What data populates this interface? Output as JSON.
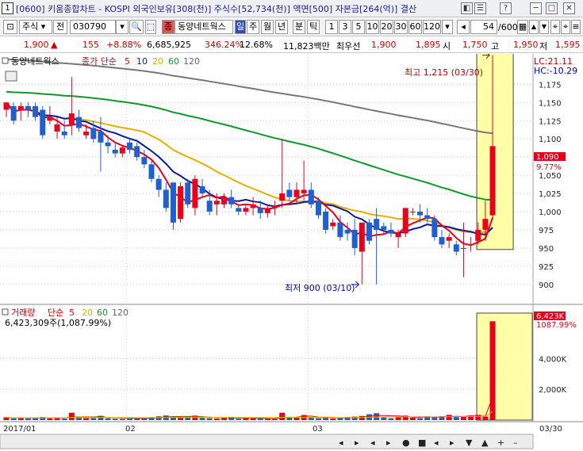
{
  "window": {
    "number": "1",
    "title": "[0600] 키움종합차트 - KOSPI 외국인보유[308(천)] 주식수[52,734(천)] 액면[500] 자본금[264(억)] 결산",
    "buttons": [
      "◧",
      "☰",
      "?",
      "─",
      "□",
      "✕"
    ]
  },
  "toolbar": {
    "asset_type": "주식",
    "jeon_label": "전",
    "code": "030790",
    "search_icon": "search-icon",
    "jong_label": "종",
    "stock_name": "동양네트웍스",
    "periods": [
      "일",
      "주",
      "월",
      "년",
      "분",
      "틱"
    ],
    "selected_period": "일",
    "intervals": [
      "1",
      "3",
      "5",
      "10",
      "20",
      "30",
      "60",
      "120"
    ],
    "count": "54",
    "total": "/600",
    "icons": [
      "left-arrow-icon",
      "grid-icon",
      "up-triangle-icon",
      "down-triangle-icon",
      "pin-icon",
      "pin-icon",
      "menu-icon"
    ]
  },
  "quote": {
    "price": "1,900",
    "arrow": "▲",
    "change": "155",
    "change_pct": "+8.88%",
    "volume": "6,685,925",
    "volume_ratio": "346.24%",
    "turnover": "12.68%",
    "amount": "11,823백만",
    "pref_label": "최우선",
    "ask": "1,900",
    "bid": "1,895",
    "open_label": "시",
    "open": "1,750",
    "high_label": "고",
    "high": "1,950",
    "low_label": "저",
    "low": "1,595"
  },
  "price_panel": {
    "stock_name": "동양네트웍스",
    "ma_title": "종가 단순",
    "ma_periods": [
      "5",
      "10",
      "20",
      "60",
      "120"
    ],
    "lc": "LC:21.11",
    "hc": "HC:-10.29",
    "last_price_label": "1,090",
    "last_pct_label": "9.77%",
    "high_annotation": "최고 1,215 (03/30)",
    "low_annotation": "최저 900 (03/10)"
  },
  "volume_panel": {
    "title": "거래량",
    "ma_title": "단순",
    "ma_periods": [
      "5",
      "20",
      "60",
      "120"
    ],
    "summary": "6,423,309주(1,087.99%)",
    "last_label": "6,423K",
    "last_pct": "1087.99%"
  },
  "chart_data": {
    "type": "candlestick",
    "price_ticks": [
      "1,175",
      "1,150",
      "1,125",
      "1,100",
      "1,075",
      "1,050",
      "1,025",
      "1,000",
      "975",
      "950",
      "925",
      "900"
    ],
    "price_ylim": [
      890,
      1195
    ],
    "volume_ticks": [
      "4,000K",
      "2,000K"
    ],
    "volume_ylim": [
      0,
      6800
    ],
    "x_labels": [
      "2017/01",
      "02",
      "03",
      "03/30"
    ],
    "ma_colors": {
      "5": "#e8001c",
      "10": "#0a1aa0",
      "20": "#e6b000",
      "60": "#0c9a2a",
      "120": "#777777"
    },
    "candles": [
      {
        "o": 1140,
        "h": 1150,
        "l": 1130,
        "c": 1150
      },
      {
        "o": 1145,
        "h": 1150,
        "l": 1120,
        "c": 1125
      },
      {
        "o": 1140,
        "h": 1150,
        "l": 1125,
        "c": 1145
      },
      {
        "o": 1145,
        "h": 1150,
        "l": 1130,
        "c": 1140
      },
      {
        "o": 1145,
        "h": 1150,
        "l": 1125,
        "c": 1130
      },
      {
        "o": 1140,
        "h": 1145,
        "l": 1100,
        "c": 1105
      },
      {
        "o": 1125,
        "h": 1145,
        "l": 1120,
        "c": 1130
      },
      {
        "o": 1110,
        "h": 1130,
        "l": 1100,
        "c": 1120
      },
      {
        "o": 1110,
        "h": 1125,
        "l": 1100,
        "c": 1105
      },
      {
        "o": 1120,
        "h": 1185,
        "l": 1105,
        "c": 1135
      },
      {
        "o": 1130,
        "h": 1140,
        "l": 1110,
        "c": 1115
      },
      {
        "o": 1105,
        "h": 1120,
        "l": 1100,
        "c": 1110
      },
      {
        "o": 1115,
        "h": 1125,
        "l": 1095,
        "c": 1100
      },
      {
        "o": 1110,
        "h": 1130,
        "l": 1055,
        "c": 1095
      },
      {
        "o": 1095,
        "h": 1105,
        "l": 1080,
        "c": 1090
      },
      {
        "o": 1085,
        "h": 1095,
        "l": 1075,
        "c": 1080
      },
      {
        "o": 1080,
        "h": 1090,
        "l": 1075,
        "c": 1088
      },
      {
        "o": 1095,
        "h": 1100,
        "l": 1080,
        "c": 1085
      },
      {
        "o": 1090,
        "h": 1095,
        "l": 1070,
        "c": 1075
      },
      {
        "o": 1075,
        "h": 1085,
        "l": 1060,
        "c": 1065
      },
      {
        "o": 1065,
        "h": 1070,
        "l": 1040,
        "c": 1045
      },
      {
        "o": 1045,
        "h": 1050,
        "l": 1020,
        "c": 1030
      },
      {
        "o": 1030,
        "h": 1040,
        "l": 1000,
        "c": 1005
      },
      {
        "o": 1040,
        "h": 1040,
        "l": 975,
        "c": 985
      },
      {
        "o": 990,
        "h": 1040,
        "l": 985,
        "c": 1035
      },
      {
        "o": 1040,
        "h": 1045,
        "l": 1005,
        "c": 1010
      },
      {
        "o": 1005,
        "h": 1050,
        "l": 995,
        "c": 1045
      },
      {
        "o": 1035,
        "h": 1045,
        "l": 1020,
        "c": 1025
      },
      {
        "o": 1015,
        "h": 1030,
        "l": 995,
        "c": 1000
      },
      {
        "o": 1010,
        "h": 1025,
        "l": 995,
        "c": 1015
      },
      {
        "o": 1010,
        "h": 1025,
        "l": 1005,
        "c": 1020
      },
      {
        "o": 1020,
        "h": 1030,
        "l": 1005,
        "c": 1010
      },
      {
        "o": 1005,
        "h": 1010,
        "l": 995,
        "c": 1000
      },
      {
        "o": 1000,
        "h": 1010,
        "l": 995,
        "c": 1005
      },
      {
        "o": 1005,
        "h": 1020,
        "l": 995,
        "c": 1010
      },
      {
        "o": 1005,
        "h": 1015,
        "l": 990,
        "c": 998
      },
      {
        "o": 998,
        "h": 1010,
        "l": 992,
        "c": 1005
      },
      {
        "o": 1005,
        "h": 1015,
        "l": 995,
        "c": 1008
      },
      {
        "o": 1015,
        "h": 1100,
        "l": 1005,
        "c": 1025
      },
      {
        "o": 1030,
        "h": 1040,
        "l": 1015,
        "c": 1020
      },
      {
        "o": 1020,
        "h": 1040,
        "l": 1010,
        "c": 1030
      },
      {
        "o": 1025,
        "h": 1070,
        "l": 1015,
        "c": 1030
      },
      {
        "o": 1030,
        "h": 1040,
        "l": 1005,
        "c": 1010
      },
      {
        "o": 1015,
        "h": 1020,
        "l": 990,
        "c": 995
      },
      {
        "o": 1000,
        "h": 1005,
        "l": 970,
        "c": 975
      },
      {
        "o": 980,
        "h": 990,
        "l": 975,
        "c": 985
      },
      {
        "o": 985,
        "h": 995,
        "l": 960,
        "c": 965
      },
      {
        "o": 975,
        "h": 985,
        "l": 960,
        "c": 970
      },
      {
        "o": 975,
        "h": 990,
        "l": 940,
        "c": 950
      },
      {
        "o": 945,
        "h": 985,
        "l": 900,
        "c": 985
      },
      {
        "o": 985,
        "h": 990,
        "l": 955,
        "c": 960
      },
      {
        "o": 990,
        "h": 1005,
        "l": 900,
        "c": 975
      },
      {
        "o": 980,
        "h": 985,
        "l": 970,
        "c": 975
      },
      {
        "o": 975,
        "h": 985,
        "l": 965,
        "c": 970
      },
      {
        "o": 965,
        "h": 975,
        "l": 950,
        "c": 970
      },
      {
        "o": 970,
        "h": 1005,
        "l": 965,
        "c": 1005
      },
      {
        "o": 1000,
        "h": 1005,
        "l": 995,
        "c": 1000
      },
      {
        "o": 1000,
        "h": 1010,
        "l": 985,
        "c": 995
      },
      {
        "o": 995,
        "h": 1005,
        "l": 985,
        "c": 990
      },
      {
        "o": 990,
        "h": 995,
        "l": 960,
        "c": 965
      },
      {
        "o": 965,
        "h": 975,
        "l": 950,
        "c": 955
      },
      {
        "o": 960,
        "h": 970,
        "l": 950,
        "c": 965
      },
      {
        "o": 955,
        "h": 960,
        "l": 940,
        "c": 945
      },
      {
        "o": 950,
        "h": 985,
        "l": 910,
        "c": 950
      },
      {
        "o": 955,
        "h": 965,
        "l": 945,
        "c": 955
      },
      {
        "o": 960,
        "h": 985,
        "l": 955,
        "c": 975
      },
      {
        "o": 975,
        "h": 1015,
        "l": 960,
        "c": 990
      },
      {
        "o": 995,
        "h": 1215,
        "l": 990,
        "c": 1090
      }
    ],
    "volumes": [
      180,
      120,
      150,
      110,
      160,
      200,
      110,
      160,
      100,
      480,
      150,
      130,
      140,
      280,
      120,
      90,
      80,
      100,
      120,
      160,
      190,
      250,
      300,
      240,
      210,
      180,
      290,
      150,
      130,
      100,
      140,
      210,
      90,
      130,
      110,
      100,
      80,
      70,
      480,
      200,
      160,
      330,
      150,
      120,
      180,
      110,
      160,
      200,
      230,
      270,
      380,
      450,
      170,
      120,
      210,
      290,
      160,
      130,
      250,
      180,
      260,
      340,
      200,
      210,
      300,
      340,
      230,
      6423
    ]
  }
}
